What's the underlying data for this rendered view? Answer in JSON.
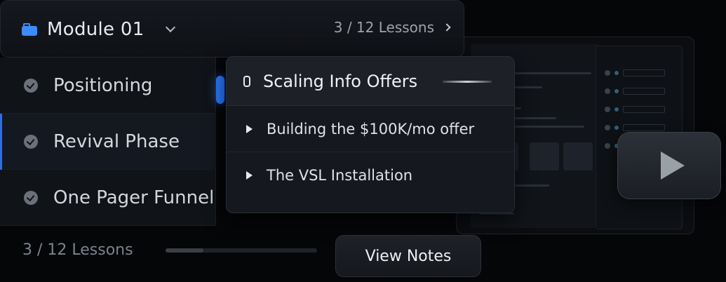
{
  "header": {
    "module_title": "Module 01",
    "lessons_count": "3 / 12 Lessons"
  },
  "sidebar": {
    "items": [
      {
        "label": "Positioning"
      },
      {
        "label": "Revival Phase"
      },
      {
        "label": "One Pager Funnel"
      }
    ]
  },
  "popup": {
    "title": "Scaling Info Offers",
    "items": [
      {
        "label": "Building the $100K/mo offer"
      },
      {
        "label": "The VSL Installation"
      }
    ]
  },
  "footer": {
    "lessons_count": "3 / 12 Lessons",
    "progress": 0.25,
    "view_notes_label": "View Notes"
  },
  "colors": {
    "accent": "#2b79ff",
    "background": "#050608"
  },
  "icons": {
    "module": "folder-icon",
    "lesson": "check-circle-icon",
    "lock": "lock-icon",
    "play": "play-icon"
  }
}
